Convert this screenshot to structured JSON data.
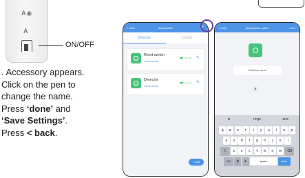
{
  "callout": {
    "onoff_label": "ON/OFF"
  },
  "device": {
    "top_mark": "A◉",
    "bottom_mark": "A"
  },
  "instructions": {
    "line1": ". Accessory appears.",
    "line2": "Click on the pen to",
    "line3": "change the name.",
    "line4_prefix": "Press ",
    "line4_bold": "‘done’",
    "line4_suffix": " and",
    "line5_bold": "‘Save Settings’",
    "line5_suffix": ".",
    "line6_prefix": "Press ",
    "line6_bold": "< back",
    "line6_suffix": "."
  },
  "phone1": {
    "appbar": {
      "back": "< back",
      "title": "accessories",
      "plus": "+"
    },
    "tabs": [
      {
        "label": "Detector"
      },
      {
        "label": "Control"
      }
    ],
    "cards": [
      {
        "name": "Reed switch",
        "sub": "normal  normal",
        "state": "Normal"
      },
      {
        "name": "Detector",
        "sub": "normal  normal",
        "state": "Normal"
      }
    ],
    "add_label": "+ add"
  },
  "phone2": {
    "appbar": {
      "back": "< back",
      "title": "Accessories option",
      "save": "save"
    },
    "name_field": "Detector name",
    "suggestions": [
      "is",
      "rings",
      "and"
    ],
    "row1": [
      "q",
      "w",
      "e",
      "r",
      "t",
      "y",
      "u",
      "i",
      "o",
      "p"
    ],
    "row2": [
      "a",
      "s",
      "d",
      "f",
      "g",
      "h",
      "j",
      "k",
      "l"
    ],
    "row3": [
      "z",
      "x",
      "c",
      "v",
      "b",
      "n",
      "m"
    ],
    "bottom": {
      "num": "123",
      "space": "space",
      "done": "done"
    }
  },
  "colors": {
    "accent": "#4d95e8",
    "green": "#49c27b",
    "ring": "#6a3f9e"
  }
}
